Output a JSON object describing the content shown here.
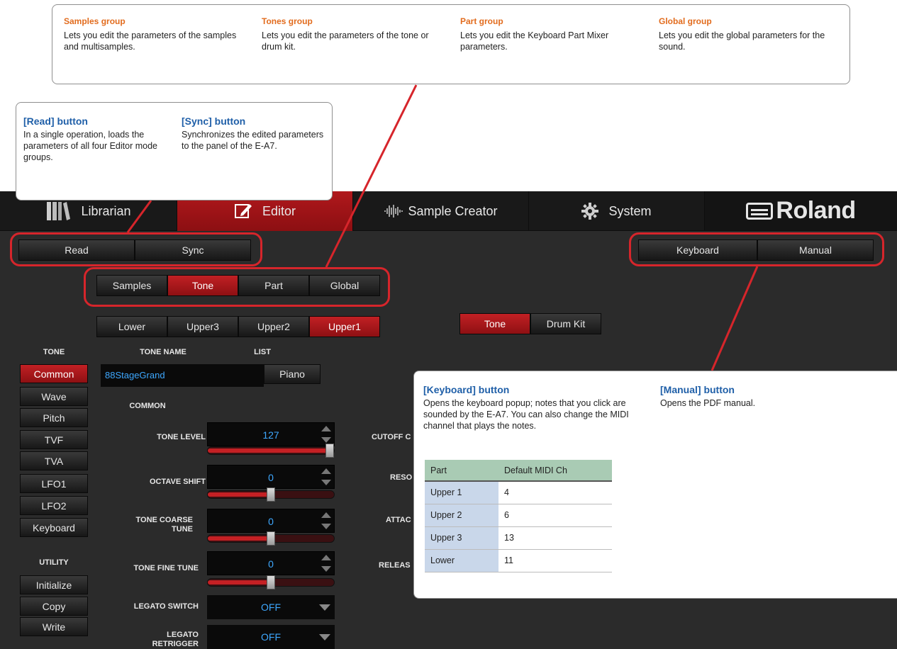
{
  "tabs": {
    "librarian": "Librarian",
    "editor": "Editor",
    "sample_creator": "Sample Creator",
    "system": "System"
  },
  "brand": "Roland",
  "toolbar": {
    "read": "Read",
    "sync": "Sync",
    "keyboard": "Keyboard",
    "manual": "Manual"
  },
  "groups": {
    "samples": "Samples",
    "tone": "Tone",
    "part": "Part",
    "global": "Global"
  },
  "parts": {
    "lower": "Lower",
    "upper3": "Upper3",
    "upper2": "Upper2",
    "upper1": "Upper1"
  },
  "tone_type": {
    "tone": "Tone",
    "drum_kit": "Drum Kit"
  },
  "sidebar": {
    "tone_heading": "TONE",
    "tone_items": [
      "Common",
      "Wave",
      "Pitch",
      "TVF",
      "TVA",
      "LFO1",
      "LFO2",
      "Keyboard"
    ],
    "utility_heading": "UTILITY",
    "utility_items": [
      "Initialize",
      "Copy",
      "Write"
    ]
  },
  "tone_panel": {
    "tone_name_heading": "TONE NAME",
    "list_heading": "LIST",
    "tone_name": "88StageGrand",
    "list_value": "Piano",
    "section": "COMMON",
    "params": [
      {
        "label": "TONE LEVEL",
        "value": "127",
        "level": 1.0
      },
      {
        "label": "OCTAVE SHIFT",
        "value": "0",
        "level": 0.5
      },
      {
        "label": "TONE COARSE TUNE",
        "value": "0",
        "level": 0.5
      },
      {
        "label": "TONE FINE TUNE",
        "value": "0",
        "level": 0.5
      }
    ],
    "legato_switch": {
      "label": "LEGATO SWITCH",
      "value": "OFF"
    },
    "legato_retrigger": {
      "label": "LEGATO RETRIGGER",
      "value": "OFF"
    },
    "right_labels": [
      "CUTOFF C",
      "RESO",
      "ATTAC",
      "RELEAS"
    ]
  },
  "callouts": {
    "groups": [
      {
        "title": "Samples group",
        "text": "Lets you edit the parameters of the samples and multisamples."
      },
      {
        "title": "Tones group",
        "text": "Lets you edit the parameters of the tone or drum kit."
      },
      {
        "title": "Part group",
        "text": "Lets you edit the Keyboard Part Mixer parameters."
      },
      {
        "title": "Global group",
        "text": "Lets you edit the global parameters for the sound."
      }
    ],
    "read": {
      "title": "[Read] button",
      "text": "In a single operation, loads the parameters of all four Editor mode groups."
    },
    "sync": {
      "title": "[Sync] button",
      "text": "Synchronizes the edited parameters to the panel of the E-A7."
    },
    "keyboard": {
      "title": "[Keyboard] button",
      "text": "Opens the keyboard popup; notes that you click are sounded by the E-A7. You can also change the MIDI channel that plays the notes."
    },
    "manual": {
      "title": "[Manual] button",
      "text": "Opens the PDF manual."
    },
    "midi_table": {
      "headers": [
        "Part",
        "Default MIDI Ch"
      ],
      "rows": [
        [
          "Upper 1",
          "4"
        ],
        [
          "Upper 2",
          "6"
        ],
        [
          "Upper 3",
          "13"
        ],
        [
          "Lower",
          "11"
        ]
      ]
    }
  },
  "colors": {
    "highlight": "#d6252b",
    "accent_red": "#b0181c",
    "value_blue": "#3ea8ff",
    "title_orange": "#e26c1e",
    "title_blue": "#1f5fa8"
  }
}
